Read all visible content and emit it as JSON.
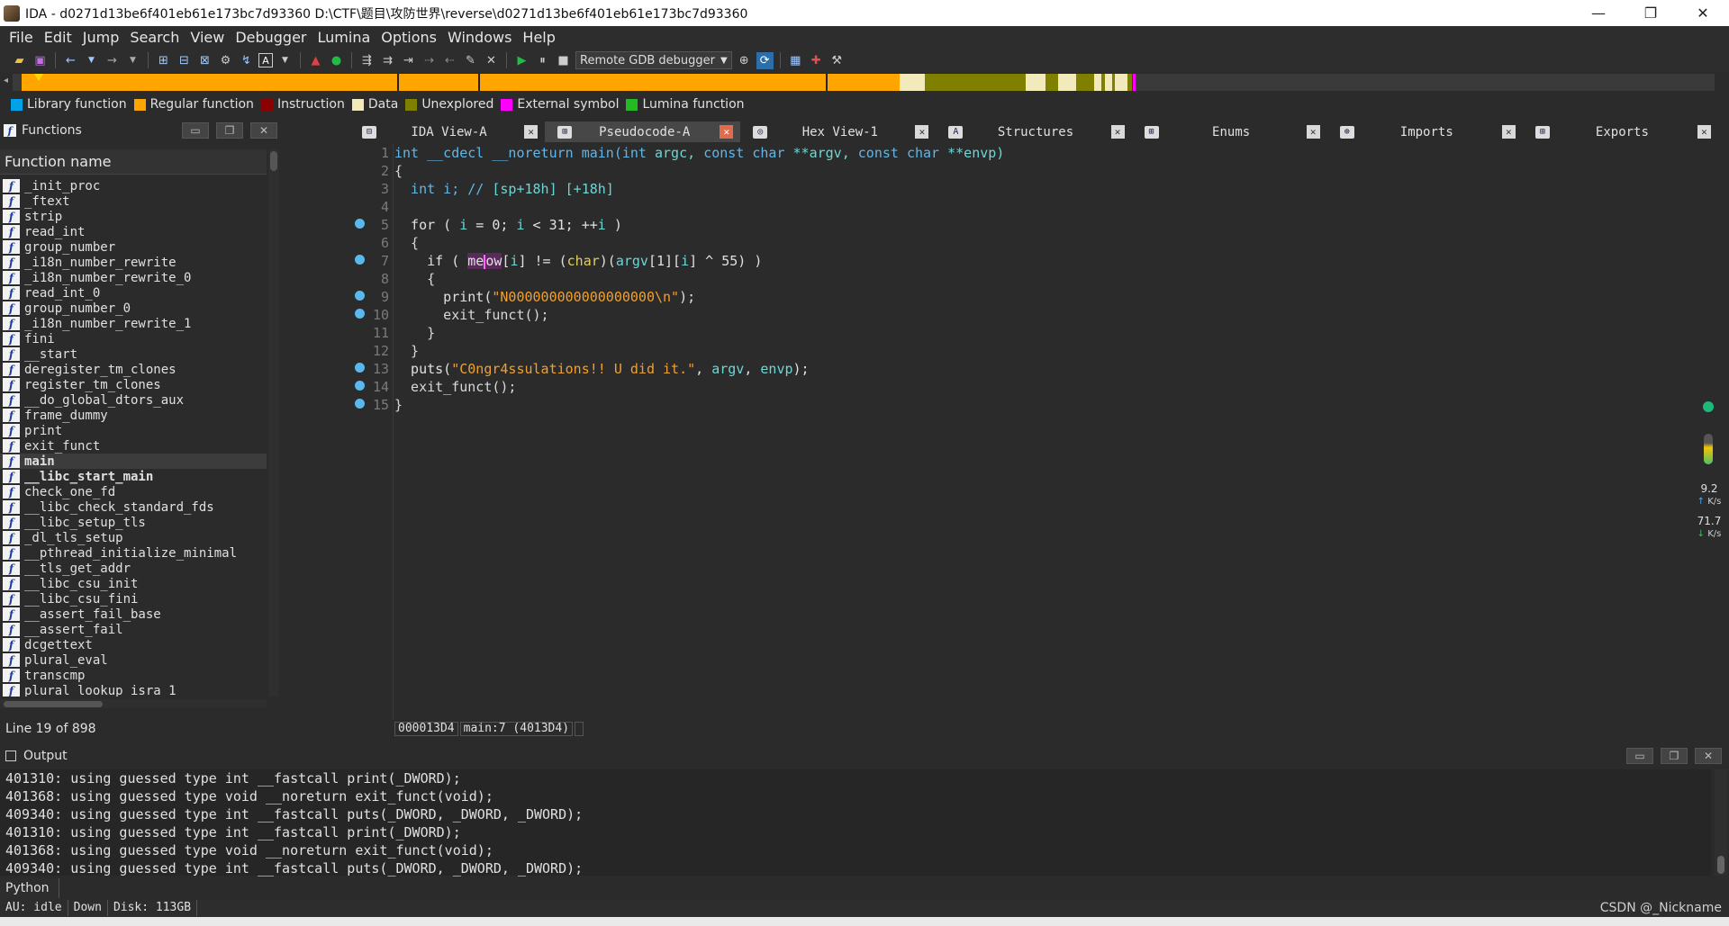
{
  "window": {
    "title": "IDA - d0271d13be6f401eb61e173bc7d93360 D:\\CTF\\题目\\攻防世界\\reverse\\d0271d13be6f401eb61e173bc7d93360",
    "minimize": "—",
    "restore": "❐",
    "close": "✕"
  },
  "menu": [
    "File",
    "Edit",
    "Jump",
    "Search",
    "View",
    "Debugger",
    "Lumina",
    "Options",
    "Windows",
    "Help"
  ],
  "toolbar": {
    "debugger_select": "Remote GDB debugger"
  },
  "legend": [
    {
      "label": "Library function",
      "color": "#00a2e8"
    },
    {
      "label": "Regular function",
      "color": "#ffa500"
    },
    {
      "label": "Instruction",
      "color": "#8b0000"
    },
    {
      "label": "Data",
      "color": "#f3eabc"
    },
    {
      "label": "Unexplored",
      "color": "#808000"
    },
    {
      "label": "External symbol",
      "color": "#ff00ff"
    },
    {
      "label": "Lumina function",
      "color": "#22bb22"
    }
  ],
  "functions_panel": {
    "title": "Functions",
    "column": "Function name",
    "items": [
      "_init_proc",
      "_ftext",
      "strip",
      "read_int",
      "group_number",
      "_i18n_number_rewrite",
      "_i18n_number_rewrite_0",
      "read_int_0",
      "group_number_0",
      "_i18n_number_rewrite_1",
      "fini",
      "__start",
      "deregister_tm_clones",
      "register_tm_clones",
      "__do_global_dtors_aux",
      "frame_dummy",
      "print",
      "exit_funct",
      "main",
      "__libc_start_main",
      "check_one_fd",
      "__libc_check_standard_fds",
      "__libc_setup_tls",
      "_dl_tls_setup",
      "__pthread_initialize_minimal",
      "__tls_get_addr",
      "__libc_csu_init",
      "__libc_csu_fini",
      "__assert_fail_base",
      "__assert_fail",
      "dcgettext",
      "plural_eval",
      "transcmp",
      "plural_lookup_isra_1"
    ],
    "selected": "main",
    "line_status": "Line 19 of 898"
  },
  "tabs": [
    {
      "label": "IDA View-A",
      "icon": "graph-icon"
    },
    {
      "label": "Pseudocode-A",
      "icon": "pseudocode-icon"
    },
    {
      "label": "Hex View-1",
      "icon": "hex-icon"
    },
    {
      "label": "Structures",
      "icon": "structures-icon"
    },
    {
      "label": "Enums",
      "icon": "enums-icon"
    },
    {
      "label": "Imports",
      "icon": "imports-icon"
    },
    {
      "label": "Exports",
      "icon": "exports-icon"
    }
  ],
  "code": {
    "line_numbers": [
      "1",
      "2",
      "3",
      "4",
      "5",
      "6",
      "7",
      "8",
      "9",
      "10",
      "11",
      "12",
      "13",
      "14",
      "15"
    ],
    "l1": {
      "a": "int __cdecl __noreturn main(",
      "b": "int",
      "c": " argc, ",
      "d": "const char",
      "e": " **argv, ",
      "f": "const char",
      "g": " **envp)"
    },
    "l2": "{",
    "l3": {
      "a": "  int i; // ",
      "b": "[sp+18h] [+18h]"
    },
    "l5": {
      "a": "  for ( ",
      "b": "i",
      "c": " = 0; ",
      "d": "i",
      "e": " < 31; ++",
      "f": "i",
      "g": " )"
    },
    "l6": "  {",
    "l7": {
      "a": "    if ( ",
      "b": "me",
      "c": "ow",
      "d": "[",
      "e": "i",
      "f": "] != (",
      "g": "char",
      "h": ")(",
      "i": "argv",
      "j": "[1][",
      "k": "i",
      "l": "] ^ 55) )"
    },
    "l8": "    {",
    "l9": {
      "a": "      print(",
      "b": "\"N000000000000000000\\n\"",
      "c": ");"
    },
    "l10": "      exit_funct();",
    "l11": "    }",
    "l12": "  }",
    "l13": {
      "a": "  puts(",
      "b": "\"C0ngr4ssulations!! U did it.\"",
      "c": ", ",
      "d": "argv",
      "e": ", ",
      "f": "envp",
      "g": ");"
    },
    "l14": "  exit_funct();",
    "l15": "}",
    "status_addr": "000013D4",
    "status_loc": "main:7 (4013D4)"
  },
  "net_widget": {
    "up_value": "9.2",
    "up_unit": "K/s",
    "down_value": "71.7",
    "down_unit": "K/s"
  },
  "output": {
    "title": "Output",
    "lines": [
      "401310: using guessed type int __fastcall print(_DWORD);",
      "401368: using guessed type void __noreturn exit_funct(void);",
      "409340: using guessed type int __fastcall puts(_DWORD, _DWORD, _DWORD);",
      "401310: using guessed type int __fastcall print(_DWORD);",
      "401368: using guessed type void __noreturn exit_funct(void);",
      "409340: using guessed type int __fastcall puts(_DWORD, _DWORD, _DWORD);"
    ]
  },
  "python_label": "Python",
  "status": {
    "au": "AU:  idle",
    "dir": "Down",
    "disk": "Disk: 113GB",
    "watermark": "CSDN @_Nickname"
  }
}
